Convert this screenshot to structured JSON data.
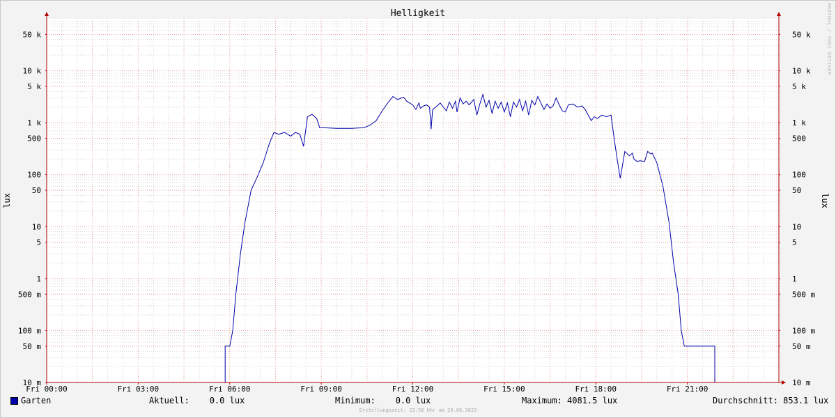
{
  "chart_data": {
    "type": "line",
    "title": "Helligkeit",
    "ylabel": "lux",
    "yscale": "log",
    "ylim": [
      0.01,
      100000
    ],
    "xlim": [
      0,
      24
    ],
    "grid": true,
    "y_ticks": [
      {
        "value": 50000,
        "label": "50 k"
      },
      {
        "value": 10000,
        "label": "10 k"
      },
      {
        "value": 5000,
        "label": "5 k"
      },
      {
        "value": 1000,
        "label": "1 k"
      },
      {
        "value": 500,
        "label": "500"
      },
      {
        "value": 100,
        "label": "100"
      },
      {
        "value": 50,
        "label": "50"
      },
      {
        "value": 10,
        "label": "10"
      },
      {
        "value": 5,
        "label": "5"
      },
      {
        "value": 1,
        "label": "1"
      },
      {
        "value": 0.5,
        "label": "500 m"
      },
      {
        "value": 0.1,
        "label": "100 m"
      },
      {
        "value": 0.05,
        "label": "50 m"
      },
      {
        "value": 0.01,
        "label": "10 m"
      }
    ],
    "x_ticks": [
      {
        "value": 0,
        "label": "Fri 00:00"
      },
      {
        "value": 3,
        "label": "Fri 03:00"
      },
      {
        "value": 6,
        "label": "Fri 06:00"
      },
      {
        "value": 9,
        "label": "Fri 09:00"
      },
      {
        "value": 12,
        "label": "Fri 12:00"
      },
      {
        "value": 15,
        "label": "Fri 15:00"
      },
      {
        "value": 18,
        "label": "Fri 18:00"
      },
      {
        "value": 21,
        "label": "Fri 21:00"
      }
    ],
    "series": [
      {
        "name": "Garten",
        "color": "#0000aa",
        "points": [
          [
            0,
            0.01
          ],
          [
            5.85,
            0.01
          ],
          [
            5.85,
            0.05
          ],
          [
            6.0,
            0.05
          ],
          [
            6.1,
            0.1
          ],
          [
            6.2,
            0.5
          ],
          [
            6.35,
            3
          ],
          [
            6.5,
            12
          ],
          [
            6.7,
            50
          ],
          [
            6.9,
            90
          ],
          [
            7.1,
            170
          ],
          [
            7.3,
            400
          ],
          [
            7.45,
            650
          ],
          [
            7.6,
            600
          ],
          [
            7.8,
            650
          ],
          [
            8.0,
            550
          ],
          [
            8.15,
            650
          ],
          [
            8.3,
            600
          ],
          [
            8.42,
            350
          ],
          [
            8.55,
            1300
          ],
          [
            8.7,
            1450
          ],
          [
            8.85,
            1200
          ],
          [
            8.95,
            800
          ],
          [
            9.1,
            800
          ],
          [
            9.5,
            780
          ],
          [
            10.0,
            780
          ],
          [
            10.4,
            800
          ],
          [
            10.6,
            900
          ],
          [
            10.8,
            1100
          ],
          [
            11.0,
            1700
          ],
          [
            11.2,
            2500
          ],
          [
            11.35,
            3200
          ],
          [
            11.5,
            2800
          ],
          [
            11.7,
            3100
          ],
          [
            11.8,
            2600
          ],
          [
            12.0,
            2200
          ],
          [
            12.1,
            1800
          ],
          [
            12.2,
            2400
          ],
          [
            12.25,
            1900
          ],
          [
            12.35,
            2100
          ],
          [
            12.45,
            2200
          ],
          [
            12.55,
            2000
          ],
          [
            12.6,
            750
          ],
          [
            12.65,
            1800
          ],
          [
            12.8,
            2100
          ],
          [
            12.9,
            2400
          ],
          [
            13.0,
            2000
          ],
          [
            13.1,
            1700
          ],
          [
            13.2,
            2500
          ],
          [
            13.3,
            1900
          ],
          [
            13.4,
            2600
          ],
          [
            13.45,
            1600
          ],
          [
            13.55,
            3000
          ],
          [
            13.65,
            2300
          ],
          [
            13.75,
            2600
          ],
          [
            13.85,
            2200
          ],
          [
            14.0,
            2800
          ],
          [
            14.1,
            1400
          ],
          [
            14.2,
            2300
          ],
          [
            14.3,
            3500
          ],
          [
            14.4,
            2000
          ],
          [
            14.5,
            2700
          ],
          [
            14.6,
            1500
          ],
          [
            14.7,
            2600
          ],
          [
            14.8,
            1900
          ],
          [
            14.9,
            2500
          ],
          [
            15.0,
            1600
          ],
          [
            15.1,
            2400
          ],
          [
            15.2,
            1300
          ],
          [
            15.3,
            2500
          ],
          [
            15.4,
            2000
          ],
          [
            15.5,
            2800
          ],
          [
            15.6,
            1700
          ],
          [
            15.7,
            2600
          ],
          [
            15.8,
            1400
          ],
          [
            15.9,
            2700
          ],
          [
            16.0,
            2200
          ],
          [
            16.1,
            3200
          ],
          [
            16.2,
            2400
          ],
          [
            16.3,
            1800
          ],
          [
            16.4,
            2300
          ],
          [
            16.5,
            1900
          ],
          [
            16.6,
            2100
          ],
          [
            16.7,
            3000
          ],
          [
            16.8,
            2200
          ],
          [
            16.9,
            1700
          ],
          [
            17.0,
            1600
          ],
          [
            17.1,
            2200
          ],
          [
            17.25,
            2300
          ],
          [
            17.4,
            2000
          ],
          [
            17.55,
            2100
          ],
          [
            17.65,
            1800
          ],
          [
            17.75,
            1400
          ],
          [
            17.85,
            1100
          ],
          [
            17.95,
            1300
          ],
          [
            18.05,
            1200
          ],
          [
            18.2,
            1400
          ],
          [
            18.35,
            1300
          ],
          [
            18.5,
            1400
          ],
          [
            18.6,
            500
          ],
          [
            18.7,
            200
          ],
          [
            18.8,
            85
          ],
          [
            18.95,
            280
          ],
          [
            19.1,
            230
          ],
          [
            19.2,
            260
          ],
          [
            19.25,
            200
          ],
          [
            19.35,
            180
          ],
          [
            19.45,
            185
          ],
          [
            19.6,
            180
          ],
          [
            19.7,
            280
          ],
          [
            19.8,
            250
          ],
          [
            19.85,
            260
          ],
          [
            20.0,
            170
          ],
          [
            20.2,
            60
          ],
          [
            20.4,
            12
          ],
          [
            20.55,
            2
          ],
          [
            20.7,
            0.5
          ],
          [
            20.8,
            0.1
          ],
          [
            20.9,
            0.05
          ],
          [
            21.9,
            0.05
          ],
          [
            21.9,
            0.01
          ],
          [
            24,
            0.01
          ]
        ]
      }
    ],
    "legend": {
      "name": "Garten",
      "current": "Aktuell:    0.0 lux",
      "minimum": "Minimum:    0.0 lux",
      "maximum": "Maximum: 4081.5 lux",
      "average": "Durchschnitt: 853.1 lux"
    }
  },
  "footer": "Erstellungszeit: 23:58 Uhr am 29.08.2025",
  "watermark": "RRDTOOL / TOBI OETIKER"
}
